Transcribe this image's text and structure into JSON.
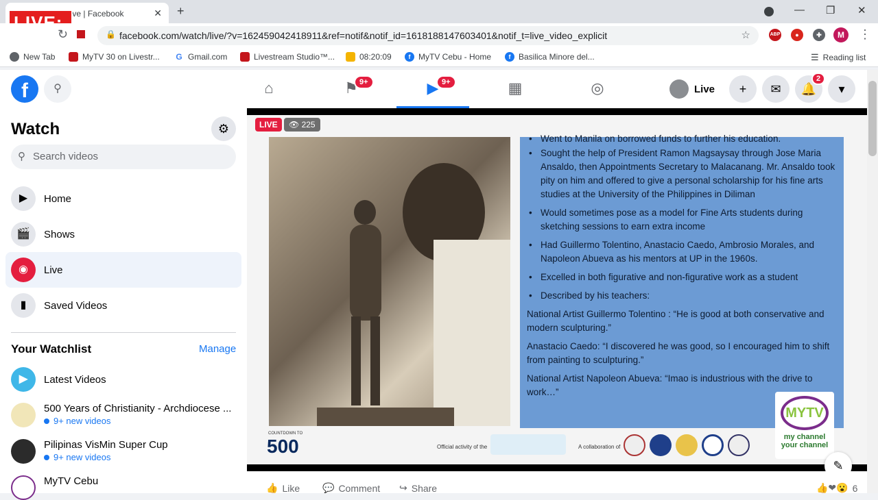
{
  "browser": {
    "tab_title": "(2) Facebook Live | Facebook",
    "overlay_live": "LIVE:",
    "url": "facebook.com/watch/live/?v=162459042418911&ref=notif&notif_id=1618188147603401&notif_t=live_video_explicit",
    "profile_initial": "M",
    "bookmarks": [
      {
        "label": "New Tab",
        "color": "#5f6368"
      },
      {
        "label": "MyTV 30 on Livestr...",
        "color": "#c4161c"
      },
      {
        "label": "Gmail.com",
        "color": "#4285f4"
      },
      {
        "label": "Livestream Studio™...",
        "color": "#c4161c"
      },
      {
        "label": "08:20:09",
        "color": "#f4b400"
      },
      {
        "label": "MyTV Cebu - Home",
        "color": "#1877f2"
      },
      {
        "label": "Basilica Minore del...",
        "color": "#1877f2"
      }
    ],
    "reading_list": "Reading list"
  },
  "fb": {
    "logo": "f",
    "nav_badges": [
      "9+",
      "9+"
    ],
    "profile_label": "Live",
    "notif_badge": "2"
  },
  "sidebar": {
    "title": "Watch",
    "search_placeholder": "Search videos",
    "items": [
      {
        "label": "Home",
        "icon": "▶"
      },
      {
        "label": "Shows",
        "icon": "🎬"
      },
      {
        "label": "Live",
        "icon": "◉"
      },
      {
        "label": "Saved Videos",
        "icon": "▮"
      }
    ],
    "watchlist_title": "Your Watchlist",
    "manage": "Manage",
    "watchlist": [
      {
        "name": "Latest Videos",
        "sub": ""
      },
      {
        "name": "500 Years of Christianity - Archdiocese ...",
        "sub": "9+ new videos"
      },
      {
        "name": "Pilipinas VisMin Super Cup",
        "sub": "9+ new videos"
      },
      {
        "name": "MyTV Cebu",
        "sub": ""
      }
    ]
  },
  "video": {
    "live": "LIVE",
    "viewers": "225",
    "slide": {
      "top_cut": "Went to Manila on borrowed funds to further his education.",
      "bullets": [
        "Sought the help of President Ramon Magsaysay through Jose Maria Ansaldo, then Appointments Secretary to Malacanang. Mr. Ansaldo took pity on him and offered to give a personal scholarship for his fine arts studies at the University of the Philippines in Diliman",
        "Would sometimes pose as a model for Fine Arts students during sketching sessions to earn extra income",
        "Had Guillermo Tolentino, Anastacio Caedo, Ambrosio Morales, and Napoleon Abueva as his mentors at UP in the 1960s.",
        "Excelled in both figurative and non-figurative work as a student",
        "Described by his teachers:"
      ],
      "quotes": [
        "National Artist Guillermo Tolentino : “He is good at both conservative and modern sculpturing.”",
        "Anastacio Caedo: “I discovered he was good, so I encouraged him to shift from painting to sculpturing.”",
        "National Artist Napoleon Abueva: “Imao is industrious with the drive to work…”"
      ]
    },
    "strip": {
      "countdown_small": "COUNTDOWN TO",
      "countdown_big": "500",
      "official": "Official activity of the",
      "collab": "A collaboration of"
    },
    "mytv_logo": "MYTV",
    "mytv_text1": "my channel",
    "mytv_text2": "your channel"
  },
  "actions": {
    "like": "Like",
    "comment": "Comment",
    "share": "Share",
    "reactions": "6"
  }
}
